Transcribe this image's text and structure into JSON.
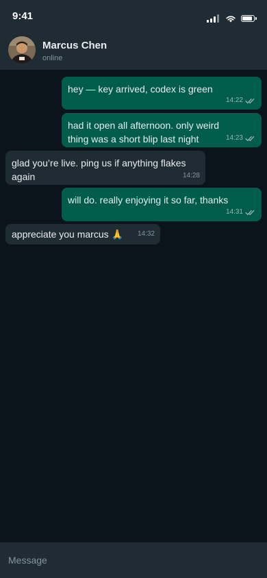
{
  "status_bar": {
    "time": "9:41",
    "icons": [
      "signal-icon",
      "wifi-icon",
      "battery-icon"
    ]
  },
  "header": {
    "contact_name": "Marcus Chen",
    "contact_status": "online"
  },
  "messages": [
    {
      "direction": "out",
      "text": "hey — key arrived, codex is green",
      "time": "14:22",
      "read": true
    },
    {
      "direction": "out",
      "text": "had it open all afternoon. only weird thing was a short blip last night",
      "time": "14:23",
      "read": true
    },
    {
      "direction": "in",
      "text": "glad you’re live. ping us if anything flakes again",
      "time": "14:28"
    },
    {
      "direction": "out",
      "text": "will do. really enjoying it so far, thanks",
      "time": "14:31",
      "read": true
    },
    {
      "direction": "in",
      "text": "appreciate you marcus 🙏",
      "time": "14:32"
    }
  ],
  "composer": {
    "placeholder": "Message"
  },
  "colors": {
    "background": "#0b141a",
    "bar": "#1f2c34",
    "outgoing_bubble": "#005c4b",
    "incoming_bubble": "#202c33",
    "secondary_text": "#8696a0"
  }
}
